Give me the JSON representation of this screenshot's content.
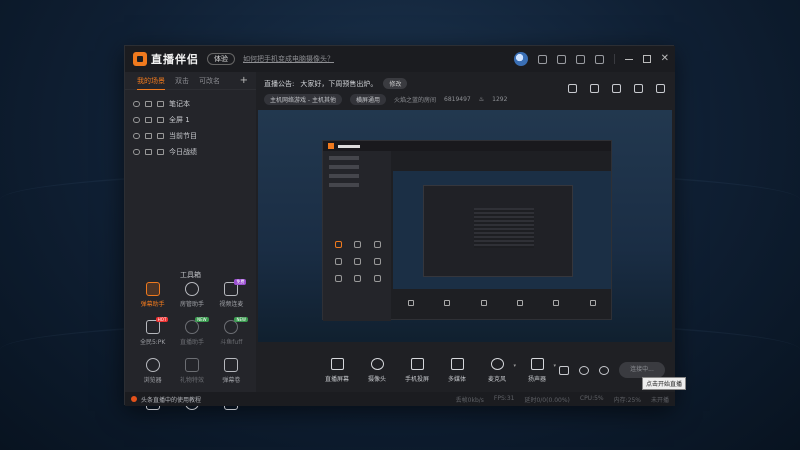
{
  "app": {
    "title": "直播伴侣",
    "version_badge": "体验",
    "notice_link": "如何把手机变成电脑摄像头？"
  },
  "sidebar": {
    "tabs": [
      "我的场景",
      "双击",
      "可改名"
    ],
    "active_tab": "我的场景",
    "add_icon": "plus-icon",
    "scenes": [
      {
        "label": "笔记本",
        "icon": "laptop-icon"
      },
      {
        "label": "全屏 1",
        "icon": "fullscreen-icon"
      },
      {
        "label": "当前节目",
        "icon": "program-icon"
      },
      {
        "label": "今日战绩",
        "icon": "scoreboard-icon"
      }
    ],
    "toolbox_title": "工具箱",
    "tools": [
      {
        "label": "弹幕助手",
        "icon": "danmaku-assistant-icon",
        "state": "active",
        "tag": ""
      },
      {
        "label": "房管助手",
        "icon": "room-manager-icon",
        "state": "normal",
        "tag": ""
      },
      {
        "label": "视频连麦",
        "icon": "video-call-icon",
        "state": "normal",
        "tag": "免费"
      },
      {
        "label": "全民5:PK",
        "icon": "pk-icon",
        "state": "normal",
        "tag": "HOT"
      },
      {
        "label": "直播助手",
        "icon": "live-helper-icon",
        "state": "dim",
        "tag": "NEW"
      },
      {
        "label": "斗鱼fuff",
        "icon": "download-icon",
        "state": "dim",
        "tag": "NEW"
      },
      {
        "label": "浏览器",
        "icon": "browser-icon",
        "state": "normal",
        "tag": ""
      },
      {
        "label": "礼物特效",
        "icon": "gift-icon",
        "state": "dim",
        "tag": ""
      },
      {
        "label": "弹幕卷",
        "icon": "danmaku-icon",
        "state": "normal",
        "tag": ""
      },
      {
        "label": "",
        "icon": "clipboard-icon",
        "state": "normal",
        "tag": ""
      },
      {
        "label": "",
        "icon": "download-icon",
        "state": "normal",
        "tag": "NEW"
      },
      {
        "label": "",
        "icon": "crown-icon",
        "state": "normal",
        "tag": ""
      }
    ]
  },
  "info": {
    "announcement_label": "直播公告:",
    "announcement_text": "大家好，下周预售出炉。",
    "edit_label": "修改",
    "category": "主机网络游戏 - 主机其他",
    "mode": "横屏通用",
    "room_name": "火焰之蓝的房间",
    "room_id": "6819497",
    "heat": "1292",
    "heat_icon": "flame-icon",
    "icons": [
      "stats-icon",
      "lock-icon",
      "gift-box-icon",
      "bell-icon",
      "share-icon"
    ]
  },
  "dock": {
    "items": [
      {
        "label": "直播屏幕",
        "icon": "screen-icon",
        "caret": false
      },
      {
        "label": "摄像头",
        "icon": "camera-icon",
        "caret": false
      },
      {
        "label": "手机投屏",
        "icon": "phone-cast-icon",
        "caret": false
      },
      {
        "label": "多媒体",
        "icon": "media-icon",
        "caret": false
      },
      {
        "label": "麦克风",
        "icon": "mic-icon",
        "caret": true
      },
      {
        "label": "扬声器",
        "icon": "speaker-icon",
        "caret": true
      }
    ],
    "right_icons": [
      "record-icon",
      "eye-icon",
      "settings-icon"
    ],
    "live_button": "连接中...",
    "tooltip": "点击开始直播"
  },
  "status": {
    "tutorial": "头条直播中的使用教程",
    "stats": [
      "丢帧0kb/s",
      "FPS:31",
      "延时0/0(0.00%)",
      "CPU:5%",
      "内存:25%",
      "未开播"
    ]
  },
  "colors": {
    "accent": "#f07a1e",
    "window_bg": "#1e1f23",
    "sidebar_bg": "#24252a"
  }
}
